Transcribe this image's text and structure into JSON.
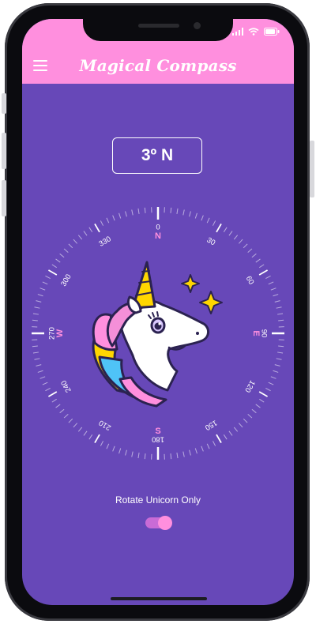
{
  "app": {
    "title": "Magical Compass"
  },
  "heading": {
    "degrees": "3º",
    "direction": "N",
    "display": "3º N"
  },
  "compass": {
    "cardinals": {
      "north": "N",
      "east": "E",
      "south": "S",
      "west": "W"
    },
    "degree_labels": [
      "0",
      "30",
      "60",
      "90",
      "120",
      "150",
      "180",
      "210",
      "240",
      "270",
      "300",
      "330"
    ]
  },
  "controls": {
    "rotate_label": "Rotate Unicorn Only",
    "rotate_unicorn_only": true
  },
  "colors": {
    "appbar": "#ff8fde",
    "background": "#6748b8",
    "cardinal": "#ff8fde",
    "text": "#ffffff"
  },
  "icons": {
    "menu": "hamburger-menu-icon",
    "unicorn": "unicorn-icon",
    "sparkle": "sparkle-icon",
    "wifi": "wifi-icon",
    "battery": "battery-icon",
    "signal": "signal-icon"
  }
}
